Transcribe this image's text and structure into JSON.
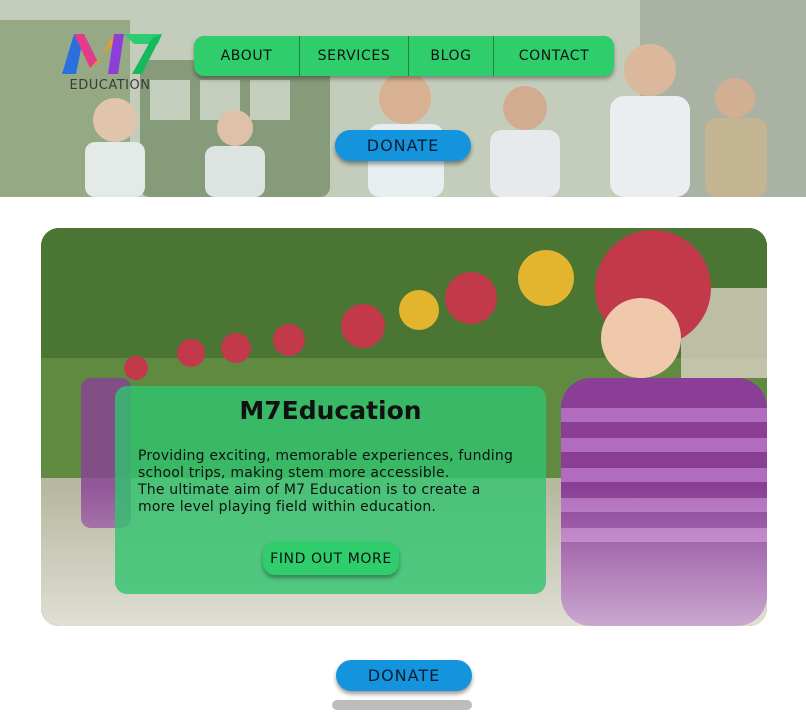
{
  "header": {
    "logo": {
      "mark": "M7",
      "text": "EDUCATION"
    },
    "nav": [
      {
        "label": "ABOUT"
      },
      {
        "label": "SERVICES"
      },
      {
        "label": "BLOG"
      },
      {
        "label": "CONTACT"
      }
    ],
    "donate_label": "DONATE"
  },
  "feature": {
    "title": "M7Education",
    "body_lines": [
      "Providing exciting, memorable experiences, funding",
      "school trips, making stem more accessible.",
      "The ultimate aim of M7 Education is to create a",
      "more level playing field within education."
    ],
    "cta_label": "FIND OUT MORE"
  },
  "footer": {
    "donate_label": "DONATE"
  },
  "colors": {
    "nav_green": "#2fcd6b",
    "donate_blue": "#1494dc",
    "card_green": "#2fc46e"
  },
  "icons": {
    "logo": "m7-logo-icon"
  }
}
